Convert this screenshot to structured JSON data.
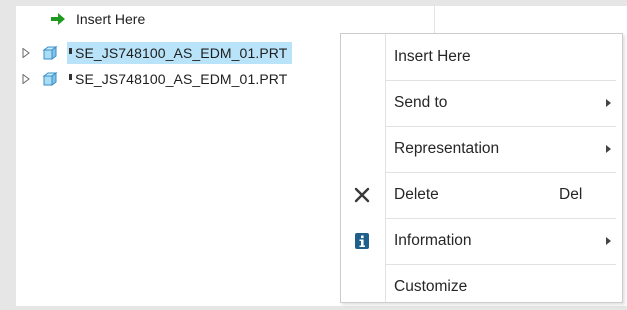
{
  "tree": {
    "insert_label": "Insert Here",
    "items": [
      {
        "label": "SE_JS748100_AS_EDM_01.PRT",
        "selected": true
      },
      {
        "label": "SE_JS748100_AS_EDM_01.PRT",
        "selected": false
      }
    ]
  },
  "context_menu": {
    "items": [
      {
        "label": "Insert Here",
        "shortcut": "",
        "submenu": false,
        "icon": ""
      },
      {
        "label": "Send to",
        "shortcut": "",
        "submenu": true,
        "icon": ""
      },
      {
        "label": "Representation",
        "shortcut": "",
        "submenu": true,
        "icon": ""
      },
      {
        "label": "Delete",
        "shortcut": "Del",
        "submenu": false,
        "icon": "delete-x-icon"
      },
      {
        "label": "Information",
        "shortcut": "",
        "submenu": true,
        "icon": "info-icon"
      },
      {
        "label": "Customize",
        "shortcut": "",
        "submenu": false,
        "icon": ""
      }
    ]
  },
  "colors": {
    "selection": "#b9e3f9",
    "insert_arrow": "#1f9a1f",
    "cube": "#3a8fc8",
    "info_badge": "#1f5f8b"
  }
}
